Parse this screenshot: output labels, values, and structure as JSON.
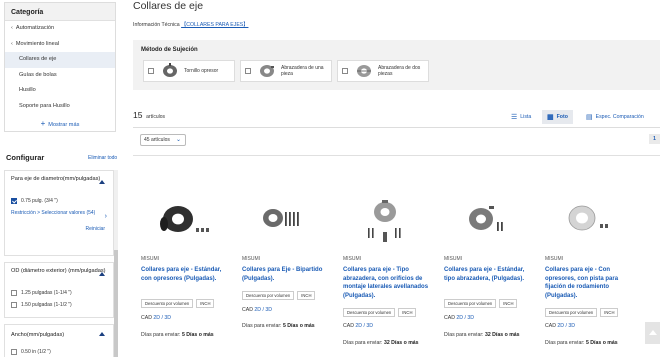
{
  "sidebar": {
    "category": {
      "title": "Categoría",
      "items": [
        {
          "label": "Automatización"
        },
        {
          "label": "Movimiento lineal"
        },
        {
          "label": "Collares de eje"
        },
        {
          "label": "Guías de bolas"
        },
        {
          "label": "Husillo"
        },
        {
          "label": "Soporte para Husillo"
        }
      ],
      "show_more": "Mostrar más"
    },
    "configure": {
      "title": "Configurar",
      "clear": "Eliminar todo"
    },
    "filters": [
      {
        "title": "Para eje de diametro(mm/pulgadas)",
        "options": [
          {
            "label": "0.75 pulg. (3/4 \")",
            "checked": true
          }
        ],
        "link": "Restricción > Seleccionar valores (54)",
        "reset": "Reiniciar"
      },
      {
        "title": "OD (diámetro exterior) (mm/pulgadas)",
        "options": [
          {
            "label": "1.25 pulgadas (1-1/4 \")",
            "checked": false
          },
          {
            "label": "1.50 pulgadas (1-1/2 \")",
            "checked": false
          }
        ]
      },
      {
        "title": "Ancho(mm/pulgadas)",
        "options": [
          {
            "label": "0.50 in (1/2 \")",
            "checked": false
          }
        ]
      }
    ]
  },
  "main": {
    "title": "Collares de eje",
    "info_prefix": "Información Técnica",
    "info_link": "【COLLARES PARA EJES】",
    "mounting": {
      "title": "Método de Sujeción",
      "options": [
        {
          "label": "Tornillo opresor"
        },
        {
          "label": "Abrazadera de una pieza"
        },
        {
          "label": "Abrazadera de dos piezas"
        }
      ]
    },
    "count": "15",
    "count_label": "artículos",
    "views": {
      "list": "Lista",
      "photo": "Foto",
      "compare": "Espec. Comparación"
    },
    "per_page": "45 artículos",
    "page": "1",
    "products": [
      {
        "brand": "MISUMI",
        "name": "Collares para eje - Estándar, con opresores (Pulgadas).",
        "badges": [
          "Descuento por volumen",
          "INCH"
        ],
        "cad_prefix": "CAD",
        "cad_link": "2D / 3D",
        "ship_label": "Días para enviar:",
        "ship_value": "5 Días o más"
      },
      {
        "brand": "MISUMI",
        "name": "Collares para Eje - Bipartido (Pulgadas).",
        "badges": [
          "Descuento por volumen",
          "INCH"
        ],
        "cad_prefix": "CAD",
        "cad_link": "2D / 3D",
        "ship_label": "Días para enviar:",
        "ship_value": "5 Días o más"
      },
      {
        "brand": "MISUMI",
        "name": "Collares para eje - Tipo abrazadera, con orificios de montaje laterales avellanados (Pulgadas).",
        "badges": [
          "Descuento por volumen",
          "INCH"
        ],
        "cad_prefix": "CAD",
        "cad_link": "2D / 3D",
        "ship_label": "Días para enviar:",
        "ship_value": "32 Días o más"
      },
      {
        "brand": "MISUMI",
        "name": "Collares para eje - Estándar, tipo abrazadera, (Pulgadas).",
        "badges": [
          "Descuento por volumen",
          "INCH"
        ],
        "cad_prefix": "CAD",
        "cad_link": "2D / 3D",
        "ship_label": "Días para enviar:",
        "ship_value": "32 Días o más"
      },
      {
        "brand": "MISUMI",
        "name": "Collares para eje - Con opresores, con pista para fijación de rodamiento (Pulgadas).",
        "badges": [
          "Descuento por volumen",
          "INCH"
        ],
        "cad_prefix": "CAD",
        "cad_link": "2D / 3D",
        "ship_label": "Días para enviar:",
        "ship_value": "5 Días o más"
      }
    ]
  }
}
